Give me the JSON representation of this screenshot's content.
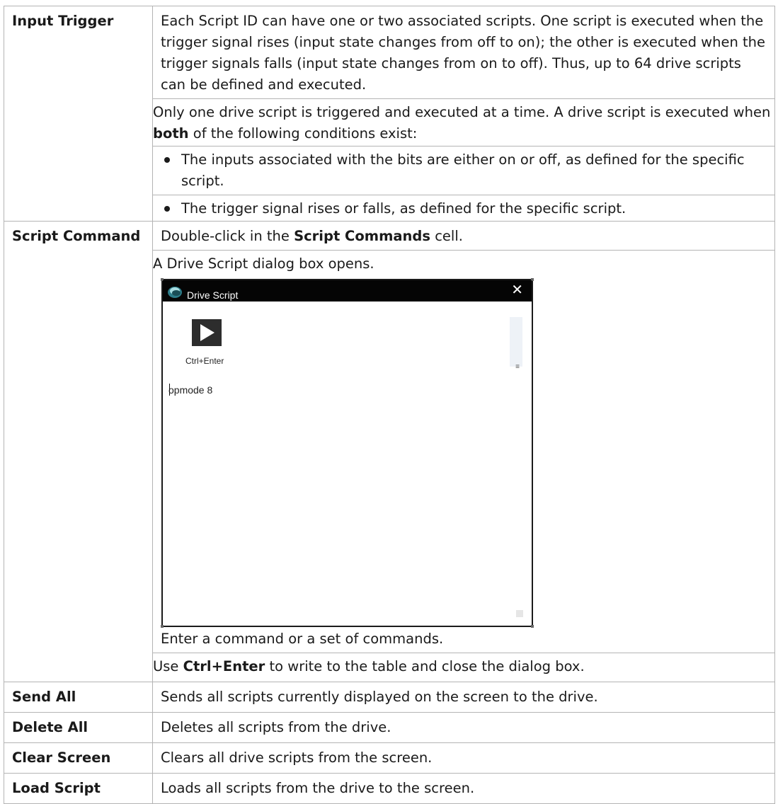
{
  "rows": [
    {
      "term": "Input Trigger",
      "para1": "Each Script ID can have one or two associated scripts. One script is executed when the trigger signal rises (input state changes from off to on); the other is executed when the trigger signals falls (input state changes from on to off). Thus, up to 64 drive scripts can be defined and executed.",
      "para2_pre": "Only one drive script is triggered and executed at a time. A drive script is executed when ",
      "para2_bold": "both",
      "para2_post": " of the following conditions exist:",
      "bullets": [
        "The inputs associated with the bits are either on or off, as defined for the specific script.",
        "The trigger signal rises or falls, as defined for the specific script."
      ]
    },
    {
      "term": "Script Command",
      "line1_pre": "Double-click in the ",
      "line1_bold": "Script Commands",
      "line1_post": " cell.",
      "line2": "A Drive Script dialog box opens.",
      "line3": "Enter a command or a set of commands.",
      "line4_pre": "Use ",
      "line4_bold": "Ctrl+Enter",
      "line4_post": " to write to the table and close the dialog box."
    },
    {
      "term": "Send All",
      "desc": "Sends all scripts currently displayed on the screen to the drive."
    },
    {
      "term": "Delete All",
      "desc": "Deletes all scripts from the drive."
    },
    {
      "term": "Clear Screen",
      "desc": "Clears all drive scripts from the screen."
    },
    {
      "term": "Load Script",
      "desc": "Loads all scripts from the drive to the screen."
    }
  ],
  "dialog": {
    "title": "Drive Script",
    "close_glyph": "✕",
    "run_caption": "Ctrl+Enter",
    "editor_text": "opmode 8",
    "icons": {
      "logo": "app-logo-icon",
      "run": "play-icon",
      "close": "close-icon"
    }
  }
}
